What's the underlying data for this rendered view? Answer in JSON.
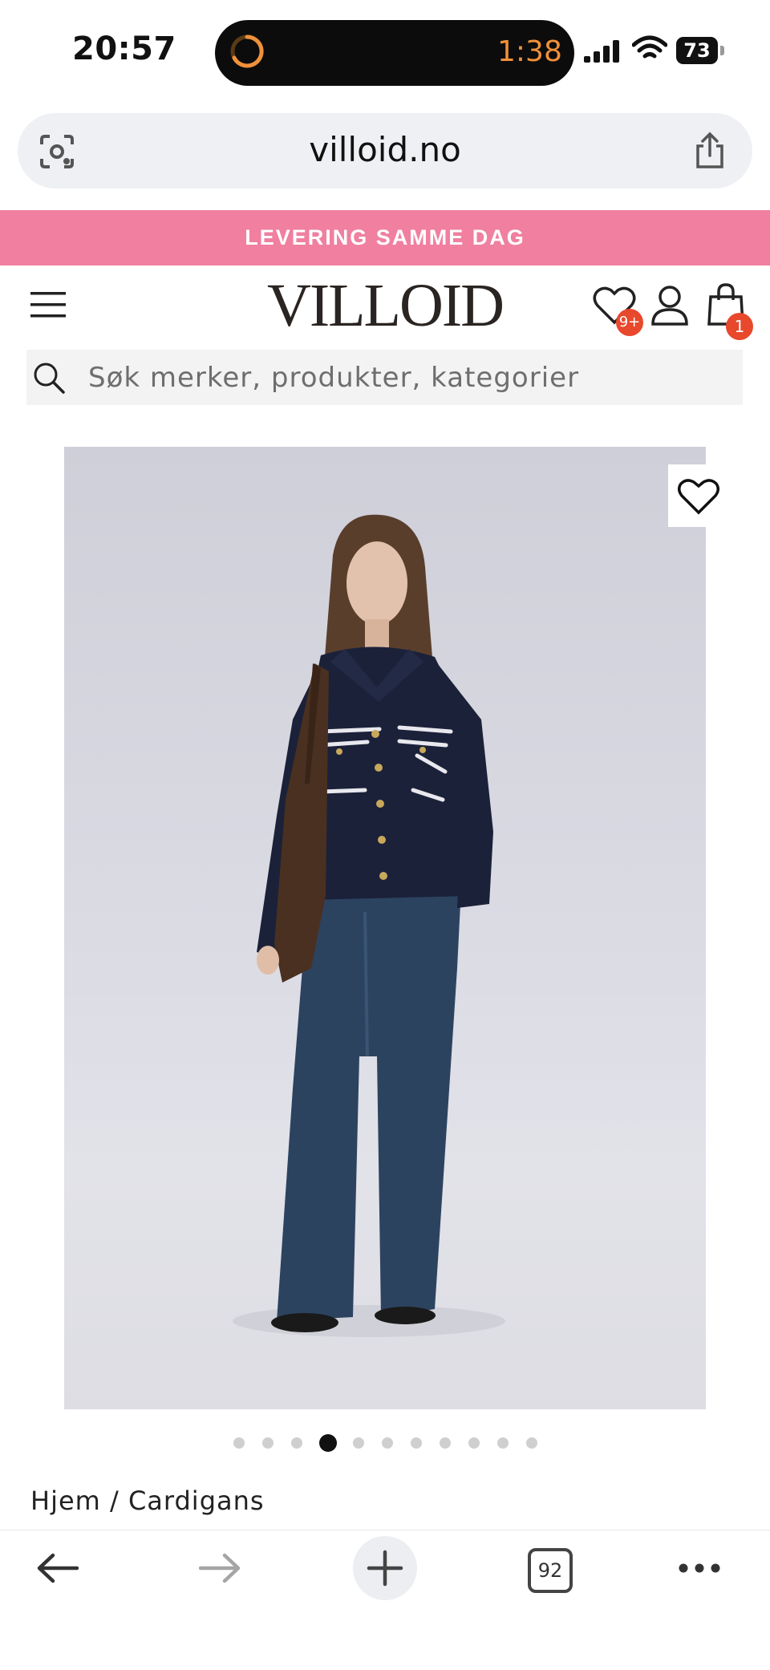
{
  "status_bar": {
    "time": "20:57",
    "timer": "1:38",
    "battery": "73"
  },
  "browser": {
    "url": "villoid.no",
    "tab_count": "92"
  },
  "promo_banner": {
    "text": "LEVERING SAMME DAG",
    "color": "#f07fa0"
  },
  "header": {
    "logo": "VILLOID",
    "wishlist_badge": "9+",
    "cart_badge": "1",
    "badge_color": "#e8482c"
  },
  "search": {
    "placeholder": "Søk merker, produkter, kategorier"
  },
  "gallery": {
    "image_alt": "Model wearing navy knit cardigan with white stripes and wide-leg jeans",
    "active_index": 4,
    "total": 11
  },
  "breadcrumb": {
    "text": "Hjem / Cardigans"
  },
  "icons": [
    "google-lens-icon",
    "share-icon",
    "menu-icon",
    "heart-icon",
    "user-icon",
    "bag-icon",
    "search-icon",
    "back-arrow-icon",
    "forward-arrow-icon",
    "plus-icon",
    "tabs-icon",
    "more-icon"
  ]
}
